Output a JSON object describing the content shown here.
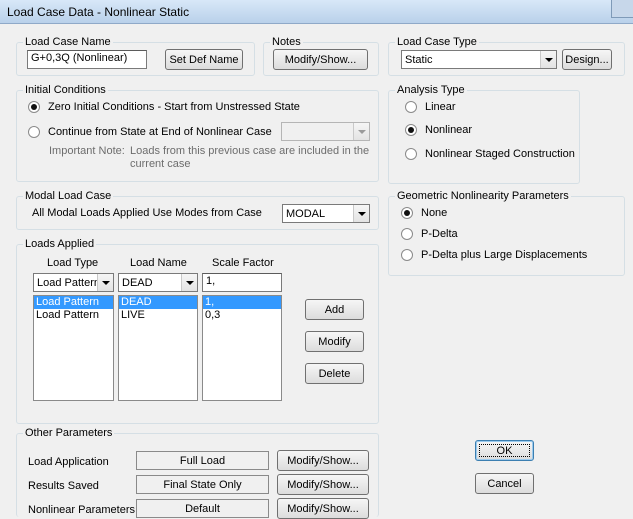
{
  "window": {
    "title": "Load Case Data - Nonlinear Static"
  },
  "load_case_name": {
    "group_label": "Load Case Name",
    "value": "G+0,3Q (Nonlinear)",
    "set_def_name_label": "Set Def Name"
  },
  "notes": {
    "group_label": "Notes",
    "button_label": "Modify/Show..."
  },
  "load_case_type": {
    "group_label": "Load Case Type",
    "selected": "Static",
    "design_label": "Design..."
  },
  "initial_conditions": {
    "group_label": "Initial Conditions",
    "option_zero": "Zero Initial Conditions - Start from Unstressed State",
    "option_continue": "Continue from State at End of Nonlinear Case",
    "continue_case_value": "",
    "note_label": "Important Note:",
    "note_line1": "Loads from this previous case are included in the",
    "note_line2": "current case",
    "selected": "zero"
  },
  "analysis_type": {
    "group_label": "Analysis Type",
    "linear": "Linear",
    "nonlinear": "Nonlinear",
    "staged": "Nonlinear Staged Construction",
    "selected": "nonlinear"
  },
  "modal_load_case": {
    "group_label": "Modal Load Case",
    "label": "All Modal Loads Applied Use Modes from Case",
    "selected": "MODAL"
  },
  "geometric_nonlinearity": {
    "group_label": "Geometric Nonlinearity Parameters",
    "none": "None",
    "pdelta": "P-Delta",
    "pdelta_large": "P-Delta plus Large Displacements",
    "selected": "none"
  },
  "loads_applied": {
    "group_label": "Loads Applied",
    "columns": {
      "load_type": "Load Type",
      "load_name": "Load Name",
      "scale_factor": "Scale Factor"
    },
    "editor": {
      "load_type": "Load Pattern",
      "load_name": "DEAD",
      "scale_factor": "1,"
    },
    "rows": [
      {
        "load_type": "Load Pattern",
        "load_name": "DEAD",
        "scale_factor": "1,"
      },
      {
        "load_type": "Load Pattern",
        "load_name": "LIVE",
        "scale_factor": "0,3"
      }
    ],
    "add_label": "Add",
    "modify_label": "Modify",
    "delete_label": "Delete"
  },
  "other_parameters": {
    "group_label": "Other Parameters",
    "load_application": {
      "label": "Load Application",
      "value": "Full Load",
      "button": "Modify/Show..."
    },
    "results_saved": {
      "label": "Results Saved",
      "value": "Final State Only",
      "button": "Modify/Show..."
    },
    "nonlinear_parameters": {
      "label": "Nonlinear Parameters",
      "value": "Default",
      "button": "Modify/Show..."
    }
  },
  "dialog": {
    "ok_label": "OK",
    "cancel_label": "Cancel"
  }
}
